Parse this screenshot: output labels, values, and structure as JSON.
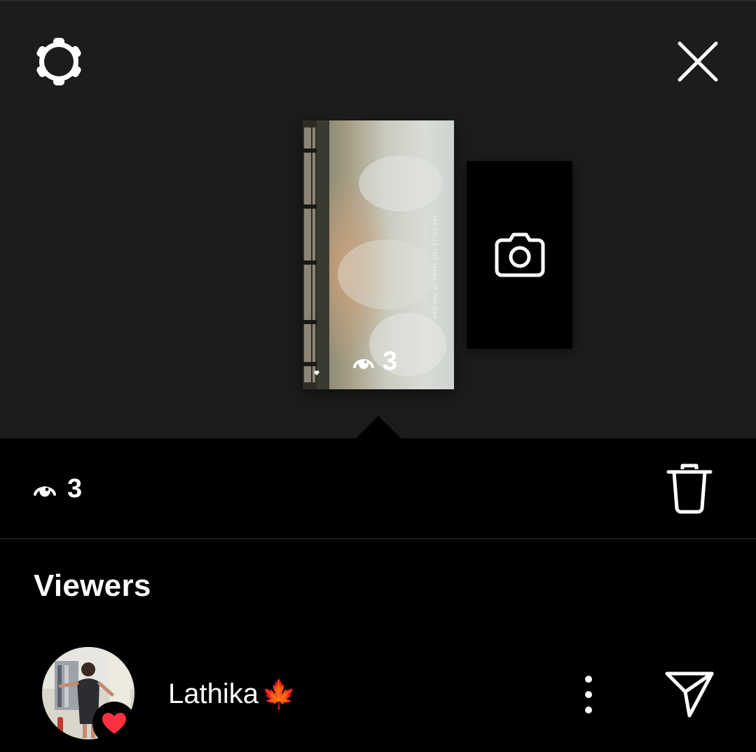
{
  "story": {
    "thumb_views": "3",
    "overlay_text": "SKY TELLS THE TALES OF THE DAY"
  },
  "stats": {
    "views": "3"
  },
  "viewers": {
    "heading": "Viewers",
    "items": [
      {
        "name": "Lathika",
        "emoji": "🍁",
        "liked": true
      }
    ]
  },
  "icons": {
    "settings": "settings-gear-icon",
    "close": "close-icon",
    "camera": "camera-icon",
    "eye": "eye-icon",
    "delete": "trash-icon",
    "more": "more-vertical-icon",
    "send": "send-icon",
    "heart": "heart-icon"
  },
  "colors": {
    "background": "#000000",
    "top_panel": "#1c1c1c",
    "heart": "#ff3040",
    "text": "#ffffff"
  }
}
